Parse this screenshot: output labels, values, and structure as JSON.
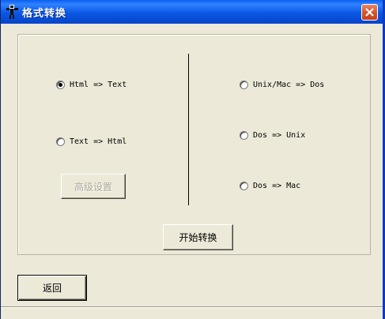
{
  "window": {
    "title": "格式转换",
    "title_icon": "figure-icon",
    "close_icon": "close-icon"
  },
  "left_options": [
    {
      "label": "Html => Text",
      "checked": true
    },
    {
      "label": "Text => Html",
      "checked": false
    }
  ],
  "right_options": [
    {
      "label": "Unix/Mac => Dos",
      "checked": false
    },
    {
      "label": "Dos => Unix",
      "checked": false
    },
    {
      "label": "Dos => Mac",
      "checked": false
    }
  ],
  "buttons": {
    "advanced_settings": "高级设置",
    "start_convert": "开始转换",
    "back": "返回"
  },
  "colors": {
    "titlebar": "#0b57e4",
    "face": "#ece9d8",
    "close": "#d4542d"
  }
}
